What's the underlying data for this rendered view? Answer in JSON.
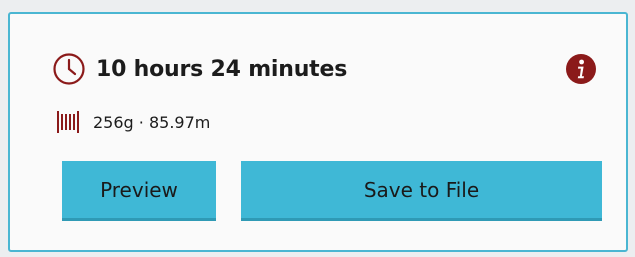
{
  "print_summary": {
    "time_estimate": "10 hours 24 minutes",
    "material_estimate": "256g · 85.97m"
  },
  "buttons": {
    "preview_label": "Preview",
    "save_label": "Save to File"
  },
  "icons": {
    "clock": "clock-icon",
    "info": "info-icon",
    "spool": "filament-spool-icon"
  },
  "colors": {
    "accent": "#3fb8d6",
    "panel_border": "#4ab6d2",
    "icon_red": "#8b1a1a"
  }
}
